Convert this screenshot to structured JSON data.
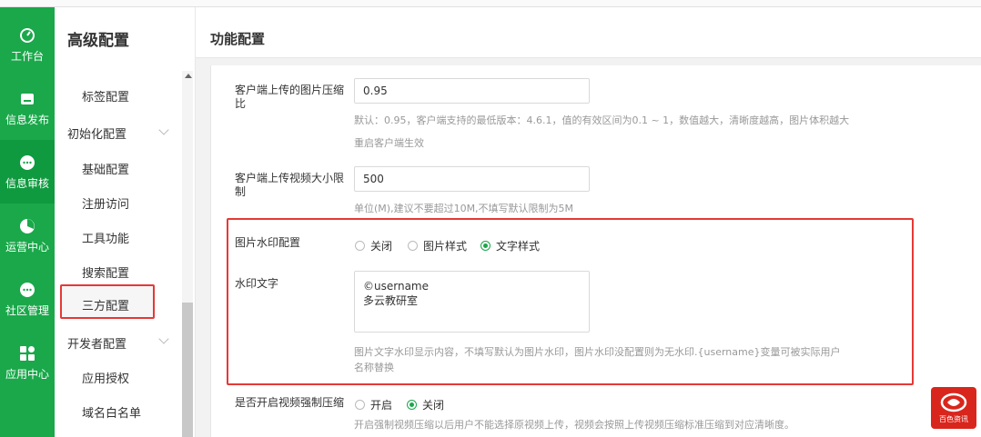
{
  "nav": {
    "rail": [
      {
        "label": "工作台",
        "icon": "dashboard-icon"
      },
      {
        "label": "信息发布",
        "icon": "publish-icon"
      },
      {
        "label": "信息审核",
        "icon": "review-icon"
      },
      {
        "label": "运营中心",
        "icon": "operations-icon"
      },
      {
        "label": "社区管理",
        "icon": "community-icon"
      },
      {
        "label": "应用中心",
        "icon": "apps-icon"
      }
    ]
  },
  "submenu": {
    "title": "高级配置",
    "items": {
      "tag": "标签配置",
      "init_group": "初始化配置",
      "basic": "基础配置",
      "register": "注册访问",
      "tools": "工具功能",
      "search": "搜索配置",
      "thirdparty": "三方配置",
      "dev_group": "开发者配置",
      "app_auth": "应用授权",
      "domain_whitelist": "域名白名单"
    }
  },
  "page": {
    "title": "功能配置"
  },
  "form": {
    "img_compress": {
      "label": "客户端上传的图片压缩比",
      "value": "0.95",
      "help1": "默认：0.95，客户端支持的最低版本：4.6.1，值的有效区间为0.1 ~ 1，数值越大，清晰度越高，图片体积越大",
      "help2": "重启客户端生效"
    },
    "video_size": {
      "label": "客户端上传视频大小限制",
      "value": "500",
      "help": "单位(M),建议不要超过10M,不填写默认限制为5M"
    },
    "watermark": {
      "label": "图片水印配置",
      "options": [
        "关闭",
        "图片样式",
        "文字样式"
      ],
      "selected": "文字样式"
    },
    "watermark_text": {
      "label": "水印文字",
      "line1": "©username",
      "line2": "多云教研室",
      "help1": "图片文字水印显示内容，不填写默认为图片水印，图片水印没配置则为无水印.{username}变量可被实际用户",
      "help2": "名称替换"
    },
    "video_compress": {
      "label": "是否开启视频强制压缩",
      "options": [
        "开启",
        "关闭"
      ],
      "selected": "关闭",
      "help": "开启强制视频压缩以后用户不能选择原视频上传，视频会按照上传视频压缩标准压缩到对应清晰度。"
    }
  },
  "watermark_logo": {
    "text": "百色资讯"
  },
  "colors": {
    "rail": "#1aa84a",
    "highlight": "#e53935",
    "radio_on": "#1aa84a"
  }
}
